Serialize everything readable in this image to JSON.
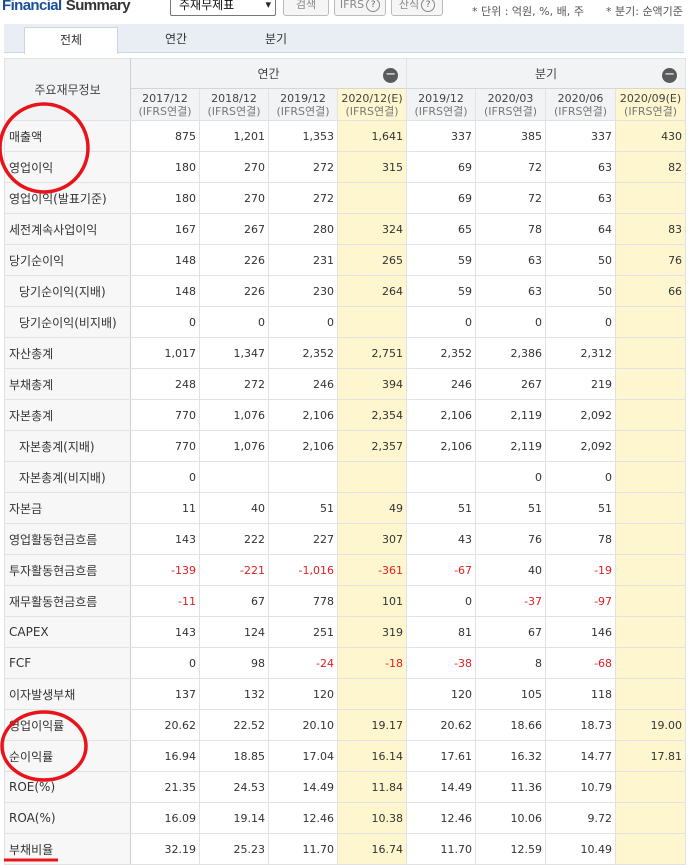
{
  "header": {
    "title_part1": "Financial",
    "title_part2": "Summary",
    "report_select": "주재무제표",
    "search_label": "검색",
    "ifrs_label": "IFRS",
    "calc_label": "산식",
    "help_glyph": "?",
    "unit_note": "* 단위 : 억원, %, 배, 주",
    "basis_note": "* 분기: 순액기준"
  },
  "tabs": [
    "전체",
    "연간",
    "분기"
  ],
  "table": {
    "corner": "주요재무정보",
    "annual_label": "연간",
    "quarter_label": "분기",
    "collapse_glyph": "−",
    "periods": [
      {
        "date": "2017/12",
        "basis": "(IFRS연결)"
      },
      {
        "date": "2018/12",
        "basis": "(IFRS연결)"
      },
      {
        "date": "2019/12",
        "basis": "(IFRS연결)"
      },
      {
        "date": "2020/12(E)",
        "basis": "(IFRS연결)"
      },
      {
        "date": "2019/12",
        "basis": "(IFRS연결)"
      },
      {
        "date": "2020/03",
        "basis": "(IFRS연결)"
      },
      {
        "date": "2020/06",
        "basis": "(IFRS연결)"
      },
      {
        "date": "2020/09(E)",
        "basis": "(IFRS연결)"
      }
    ],
    "rows": [
      {
        "label": "매출액",
        "indent": false,
        "values": [
          "875",
          "1,201",
          "1,353",
          "1,641",
          "337",
          "385",
          "337",
          "430"
        ]
      },
      {
        "label": "영업이익",
        "indent": false,
        "values": [
          "180",
          "270",
          "272",
          "315",
          "69",
          "72",
          "63",
          "82"
        ]
      },
      {
        "label": "영업이익(발표기준)",
        "indent": false,
        "values": [
          "180",
          "270",
          "272",
          "",
          "69",
          "72",
          "63",
          ""
        ]
      },
      {
        "label": "세전계속사업이익",
        "indent": false,
        "values": [
          "167",
          "267",
          "280",
          "324",
          "65",
          "78",
          "64",
          "83"
        ]
      },
      {
        "label": "당기순이익",
        "indent": false,
        "values": [
          "148",
          "226",
          "231",
          "265",
          "59",
          "63",
          "50",
          "76"
        ]
      },
      {
        "label": "당기순이익(지배)",
        "indent": true,
        "values": [
          "148",
          "226",
          "230",
          "264",
          "59",
          "63",
          "50",
          "66"
        ]
      },
      {
        "label": "당기순이익(비지배)",
        "indent": true,
        "values": [
          "0",
          "0",
          "0",
          "",
          "0",
          "0",
          "0",
          ""
        ]
      },
      {
        "label": "자산총계",
        "indent": false,
        "values": [
          "1,017",
          "1,347",
          "2,352",
          "2,751",
          "2,352",
          "2,386",
          "2,312",
          ""
        ]
      },
      {
        "label": "부채총계",
        "indent": false,
        "values": [
          "248",
          "272",
          "246",
          "394",
          "246",
          "267",
          "219",
          ""
        ]
      },
      {
        "label": "자본총계",
        "indent": false,
        "values": [
          "770",
          "1,076",
          "2,106",
          "2,354",
          "2,106",
          "2,119",
          "2,092",
          ""
        ]
      },
      {
        "label": "자본총계(지배)",
        "indent": true,
        "values": [
          "770",
          "1,076",
          "2,106",
          "2,357",
          "2,106",
          "2,119",
          "2,092",
          ""
        ]
      },
      {
        "label": "자본총계(비지배)",
        "indent": true,
        "values": [
          "0",
          "",
          "",
          "",
          "",
          "0",
          "0",
          ""
        ]
      },
      {
        "label": "자본금",
        "indent": false,
        "values": [
          "11",
          "40",
          "51",
          "49",
          "51",
          "51",
          "51",
          ""
        ]
      },
      {
        "label": "영업활동현금흐름",
        "indent": false,
        "values": [
          "143",
          "222",
          "227",
          "307",
          "43",
          "76",
          "78",
          ""
        ]
      },
      {
        "label": "투자활동현금흐름",
        "indent": false,
        "values": [
          "-139",
          "-221",
          "-1,016",
          "-361",
          "-67",
          "40",
          "-19",
          ""
        ]
      },
      {
        "label": "재무활동현금흐름",
        "indent": false,
        "values": [
          "-11",
          "67",
          "778",
          "101",
          "0",
          "-37",
          "-97",
          ""
        ]
      },
      {
        "label": "CAPEX",
        "indent": false,
        "values": [
          "143",
          "124",
          "251",
          "319",
          "81",
          "67",
          "146",
          ""
        ]
      },
      {
        "label": "FCF",
        "indent": false,
        "values": [
          "0",
          "98",
          "-24",
          "-18",
          "-38",
          "8",
          "-68",
          ""
        ]
      },
      {
        "label": "이자발생부채",
        "indent": false,
        "values": [
          "137",
          "132",
          "120",
          "",
          "120",
          "105",
          "118",
          ""
        ]
      },
      {
        "label": "영업이익률",
        "indent": false,
        "values": [
          "20.62",
          "22.52",
          "20.10",
          "19.17",
          "20.62",
          "18.66",
          "18.73",
          "19.00"
        ]
      },
      {
        "label": "순이익률",
        "indent": false,
        "values": [
          "16.94",
          "18.85",
          "17.04",
          "16.14",
          "17.61",
          "16.32",
          "14.77",
          "17.81"
        ]
      },
      {
        "label": "ROE(%)",
        "indent": false,
        "values": [
          "21.35",
          "24.53",
          "14.49",
          "11.84",
          "14.49",
          "11.36",
          "10.79",
          ""
        ]
      },
      {
        "label": "ROA(%)",
        "indent": false,
        "values": [
          "16.09",
          "19.14",
          "12.46",
          "10.38",
          "12.46",
          "10.06",
          "9.72",
          ""
        ]
      },
      {
        "label": "부채비율",
        "indent": false,
        "values": [
          "32.19",
          "25.23",
          "11.70",
          "16.74",
          "11.70",
          "12.59",
          "10.49",
          ""
        ]
      }
    ]
  },
  "colors": {
    "estimate_bg": "#fdf6cf",
    "negative": "#e02020",
    "annotation": "#e8141a",
    "title_blue": "#1a4fa0"
  }
}
